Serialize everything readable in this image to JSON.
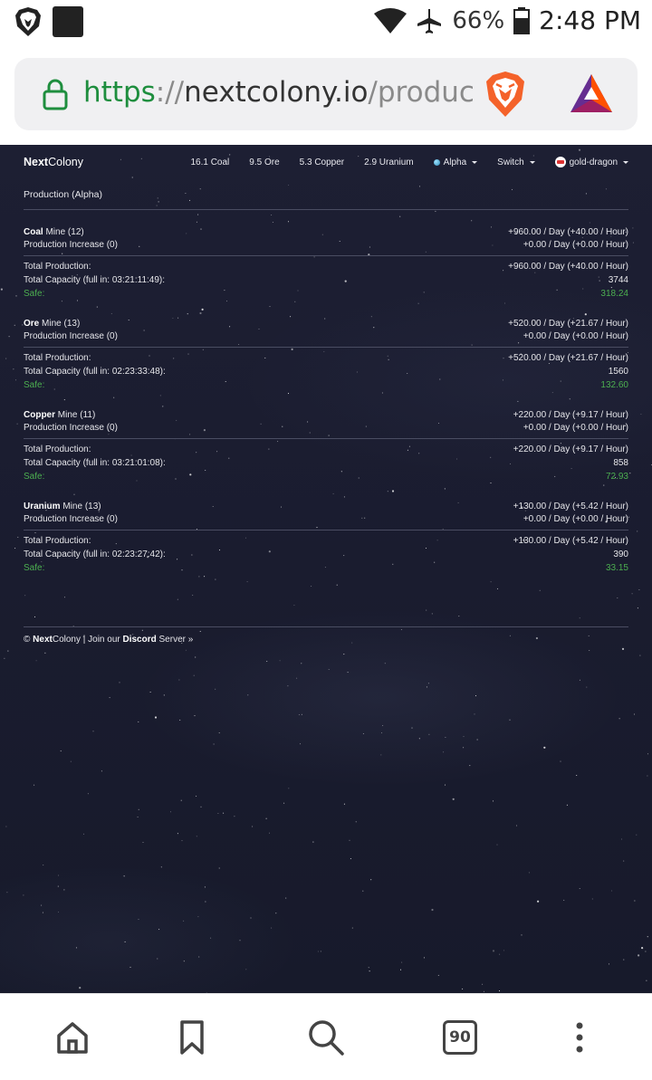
{
  "status_bar": {
    "battery_percent": "66%",
    "time": "2:48 PM"
  },
  "browser": {
    "url_scheme": "https",
    "url_sep": "://",
    "url_host": "nextcolony.io",
    "url_path": "/producti",
    "tab_count": "90"
  },
  "header": {
    "brand_bold": "Next",
    "brand_rest": "Colony",
    "resources": [
      "16.1 Coal",
      "9.5 Ore",
      "5.3 Copper",
      "2.9 Uranium"
    ],
    "menu_alpha": "Alpha",
    "menu_switch": "Switch",
    "menu_user": "gold-dragon"
  },
  "page_title": "Production (Alpha)",
  "labels": {
    "mine": "Mine",
    "production_increase": "Production Increase (0)",
    "total_production": "Total Production:",
    "total_capacity_prefix": "Total Capacity (full in:",
    "safe": "Safe:"
  },
  "mines": [
    {
      "name": "Coal",
      "level": "(12)",
      "rate": "+960.00 / Day (+40.00 / Hour)",
      "increase": "+0.00 / Day (+0.00 / Hour)",
      "total_rate": "+960.00 / Day (+40.00 / Hour)",
      "full_in": "03:21:11:49",
      "capacity": "3744",
      "safe": "318.24"
    },
    {
      "name": "Ore",
      "level": "(13)",
      "rate": "+520.00 / Day (+21.67 / Hour)",
      "increase": "+0.00 / Day (+0.00 / Hour)",
      "total_rate": "+520.00 / Day (+21.67 / Hour)",
      "full_in": "02:23:33:48",
      "capacity": "1560",
      "safe": "132.60"
    },
    {
      "name": "Copper",
      "level": "(11)",
      "rate": "+220.00 / Day (+9.17 / Hour)",
      "increase": "+0.00 / Day (+0.00 / Hour)",
      "total_rate": "+220.00 / Day (+9.17 / Hour)",
      "full_in": "03:21:01:08",
      "capacity": "858",
      "safe": "72.93"
    },
    {
      "name": "Uranium",
      "level": "(13)",
      "rate": "+130.00 / Day (+5.42 / Hour)",
      "increase": "+0.00 / Day (+0.00 / Hour)",
      "total_rate": "+130.00 / Day (+5.42 / Hour)",
      "full_in": "02:23:27:42",
      "capacity": "390",
      "safe": "33.15"
    }
  ],
  "footer": {
    "copyright": "©",
    "brand_bold": "Next",
    "brand_rest": "Colony",
    "join_text": "| Join our",
    "discord": "Discord",
    "server_text": "Server »"
  },
  "colors": {
    "safe_green": "#4caf50",
    "url_green": "#1e8e3e",
    "background": "#1b1d30"
  }
}
